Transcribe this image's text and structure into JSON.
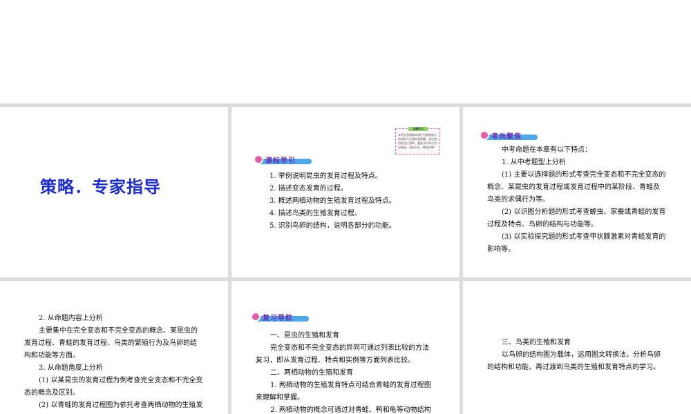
{
  "slide1": {
    "title": "策略．专家指导"
  },
  "slide2": {
    "tip_title": "温馨提示",
    "tip_body": "本页信息随着本课件可能随部分的选取不合理标准提醒。请在使用前自行判断，重复访问并可点击链接，若有不妥，敬请谅解！",
    "badge": "课标导引",
    "items": [
      "1. 举例说明昆虫的发育过程及特点。",
      "2. 描述变态发育的过程。",
      "3. 概述两栖动物的生殖发育过程及特点。",
      "4. 描述鸟类的生殖发育过程。",
      "5. 识别鸟卵的结构，说明各部分的功能。"
    ]
  },
  "slide3": {
    "badge": "考向聚焦",
    "lines": [
      "中考命题在本章有以下特点：",
      "1. 从中考题型上分析",
      "(1) 主要以选择题的形式考查完全变态和不完全变态的",
      "概念、某昆虫的发育过程或发育过程中的某阶段、青蛙及",
      "鸟类的求偶行为等。",
      "(2) 以识图分析题的形式考查蝗虫、家蚕或青蛙的发育",
      "过程及特点、鸟卵的结构与功能等。",
      "(3) 以实验探究题的形式考查甲状腺激素对青蛙发育的",
      "影响等。"
    ]
  },
  "slide4": {
    "lines": [
      "2. 从命题内容上分析",
      "主要集中在完全变态和不完全变态的概念、某昆虫的",
      "发育过程、青蛙的发育过程、鸟类的繁殖行为及鸟卵的结",
      "构和功能等方面。",
      "3. 从命题角度上分析",
      "(1) 以某昆虫的发育过程为例考查完全变态和不完全变",
      "态的概念及区别。",
      "(2) 以青蛙的发育过程图为依托考查两栖动物的生殖发"
    ]
  },
  "slide5": {
    "badge": "复习导航",
    "lines": [
      "一、昆虫的生殖和发育",
      "完全变态和不完全变态的异同可通过列表比较的方法",
      "复习，即从发育过程、特点和实例等方面列表比较。",
      "二、两栖动物的生殖和发育",
      "1. 两栖动物的生殖发育特点可结合青蛙的发育过程图",
      "来理解和掌握。",
      "2. 两栖动物的概念可通过对青蛙、鸭和龟等动物结构"
    ]
  },
  "slide6": {
    "lines": [
      "三、鸟类的生殖和发育",
      "以鸟卵的结构图为载体，运用图文转换法，分析鸟卵",
      "的结构和功能，再过渡到鸟类的生殖和发育特点的学习。"
    ]
  }
}
